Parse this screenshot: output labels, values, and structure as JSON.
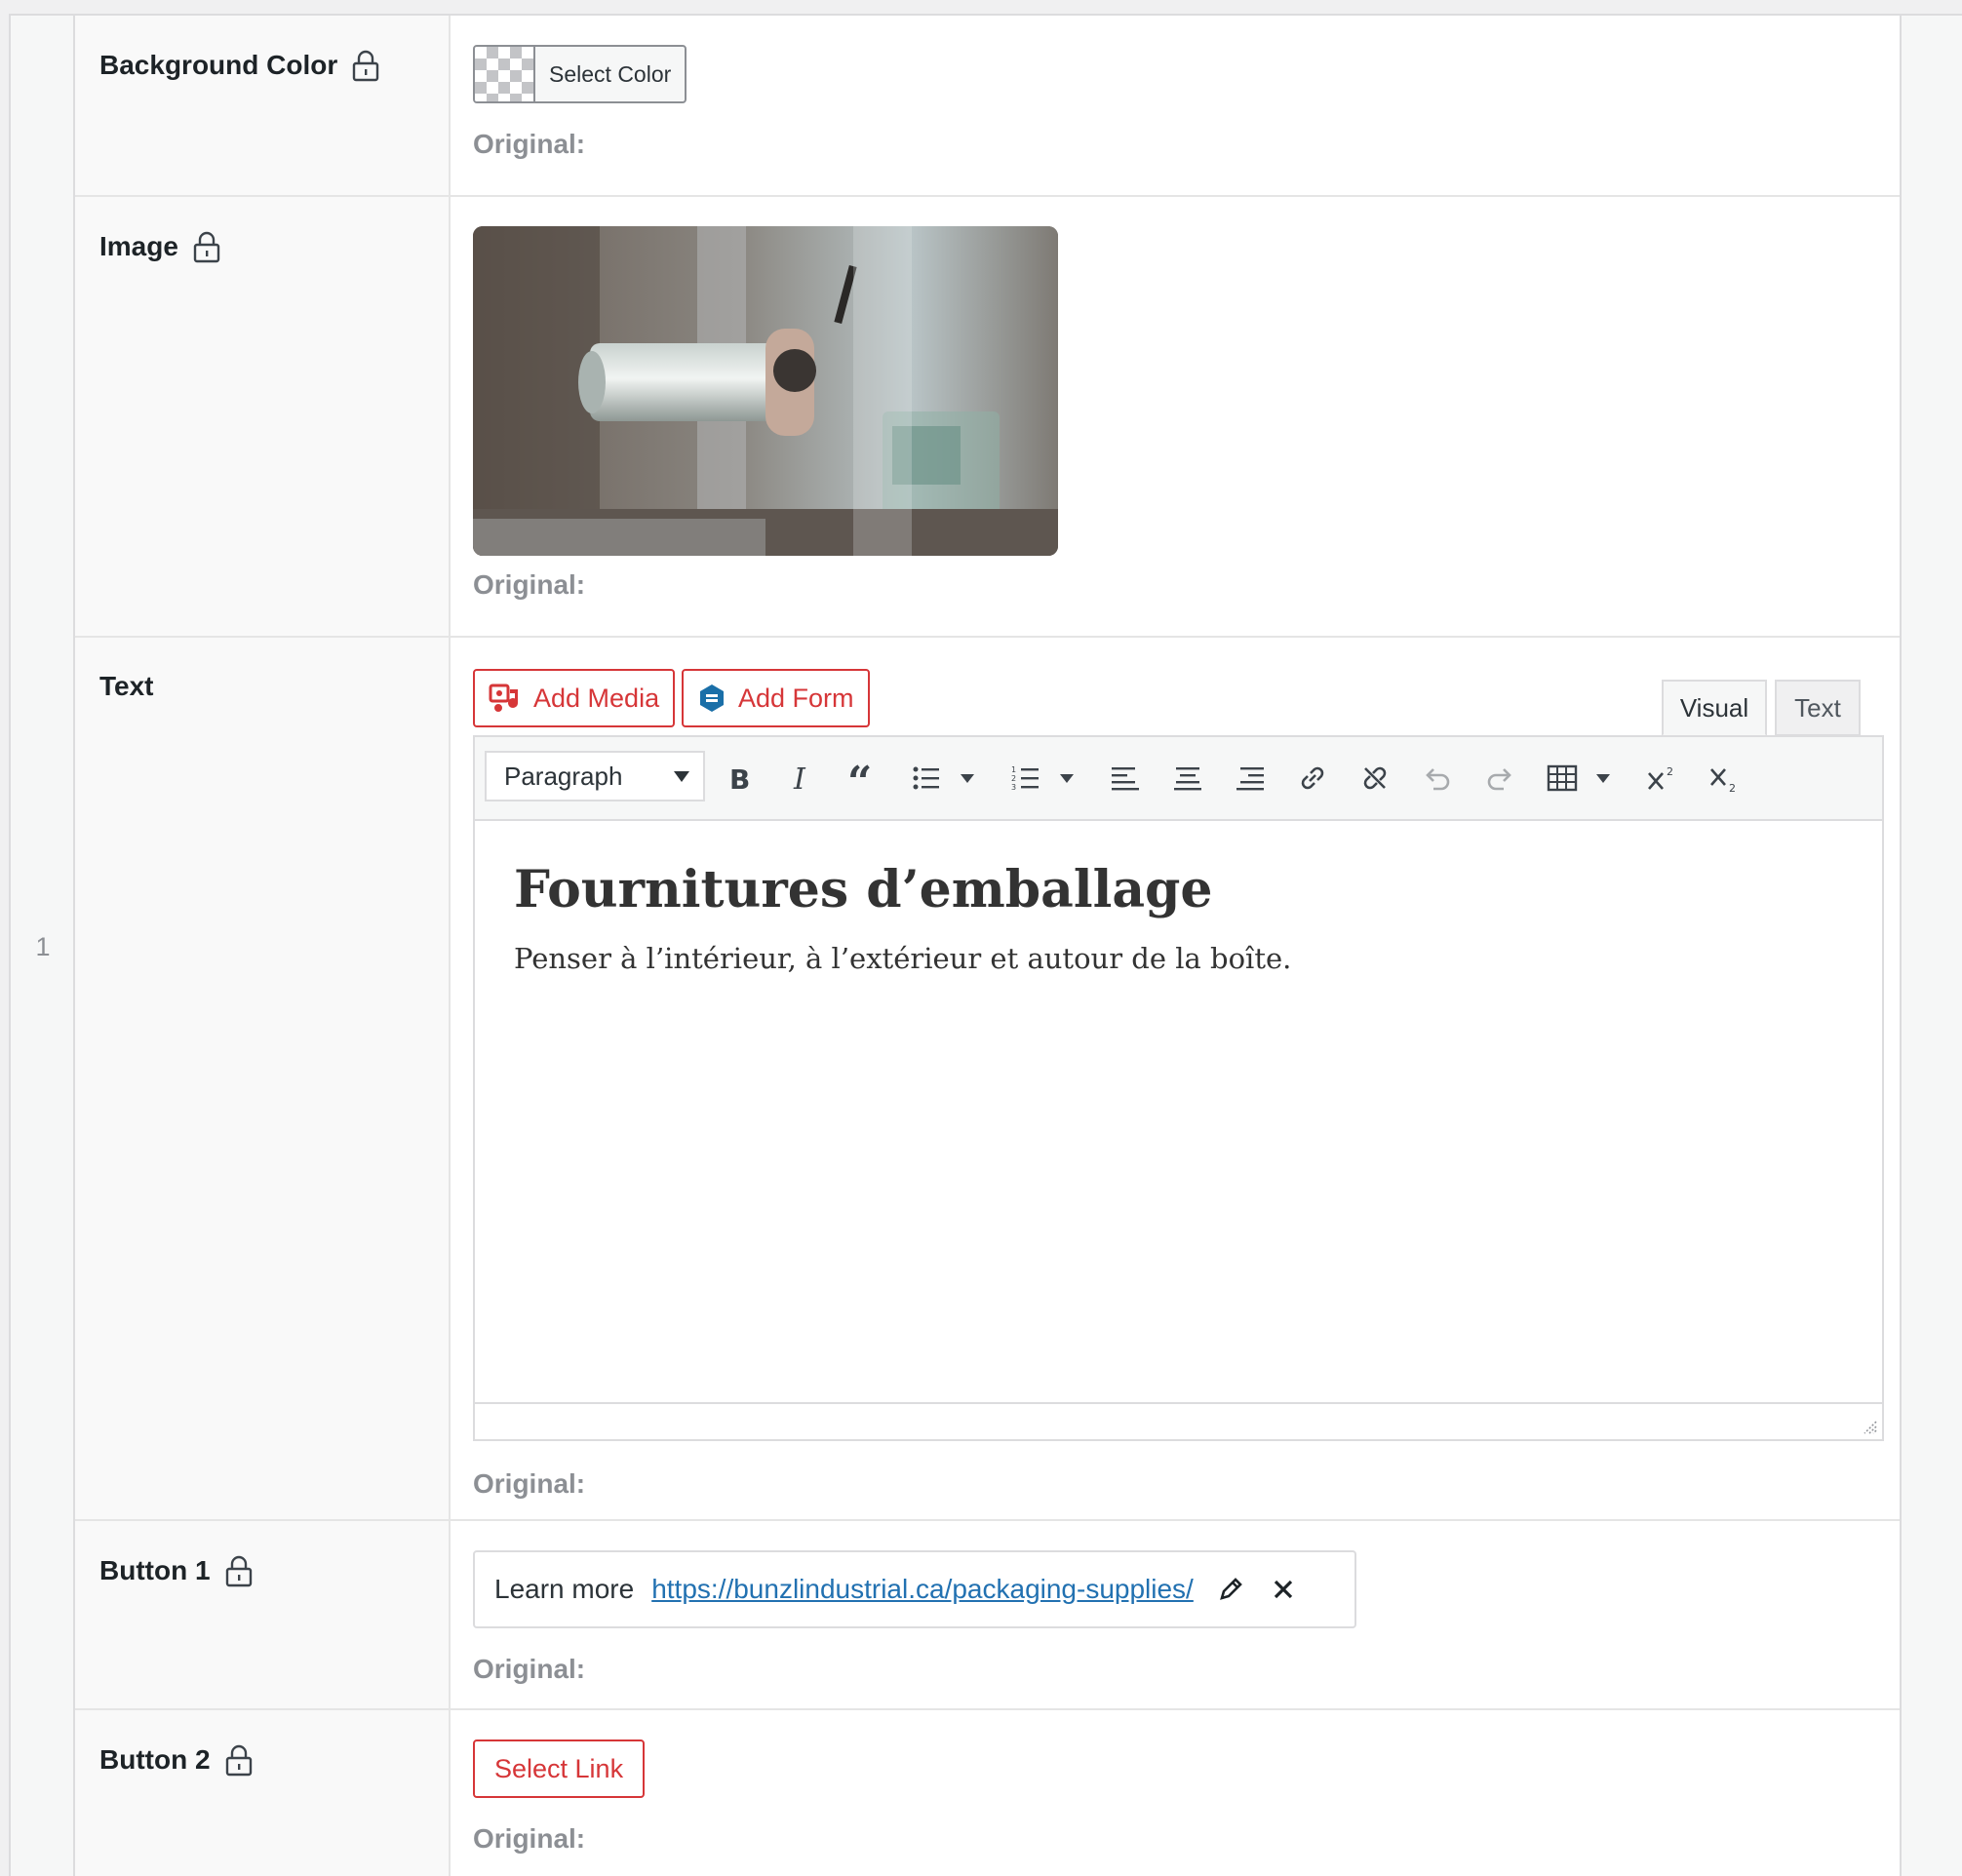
{
  "row_number": "1",
  "original_label": "Original:",
  "fields": {
    "background_color": {
      "label": "Background Color",
      "button_label": "Select Color"
    },
    "image": {
      "label": "Image"
    },
    "text": {
      "label": "Text",
      "add_media_label": "Add Media",
      "add_form_label": "Add Form",
      "tab_visual": "Visual",
      "tab_text": "Text",
      "format_select_value": "Paragraph",
      "content_heading": "Fournitures d’emballage",
      "content_paragraph": "Penser à l’intérieur, à l’extérieur et autour de la boîte."
    },
    "button1": {
      "label": "Button 1",
      "link_title": "Learn more",
      "link_url": "https://bunzlindustrial.ca/packaging-supplies/"
    },
    "button2": {
      "label": "Button 2",
      "select_link_label": "Select Link"
    }
  },
  "toolbar_icons": [
    "bold-icon",
    "italic-icon",
    "blockquote-icon",
    "bullet-list-icon",
    "numbered-list-icon",
    "align-left-icon",
    "align-center-icon",
    "align-right-icon",
    "link-icon",
    "unlink-icon",
    "undo-icon",
    "redo-icon",
    "table-icon",
    "superscript-icon",
    "subscript-icon"
  ],
  "colors": {
    "accent_red": "#d63638",
    "link_blue": "#2271b1",
    "muted": "#8c8f94"
  }
}
